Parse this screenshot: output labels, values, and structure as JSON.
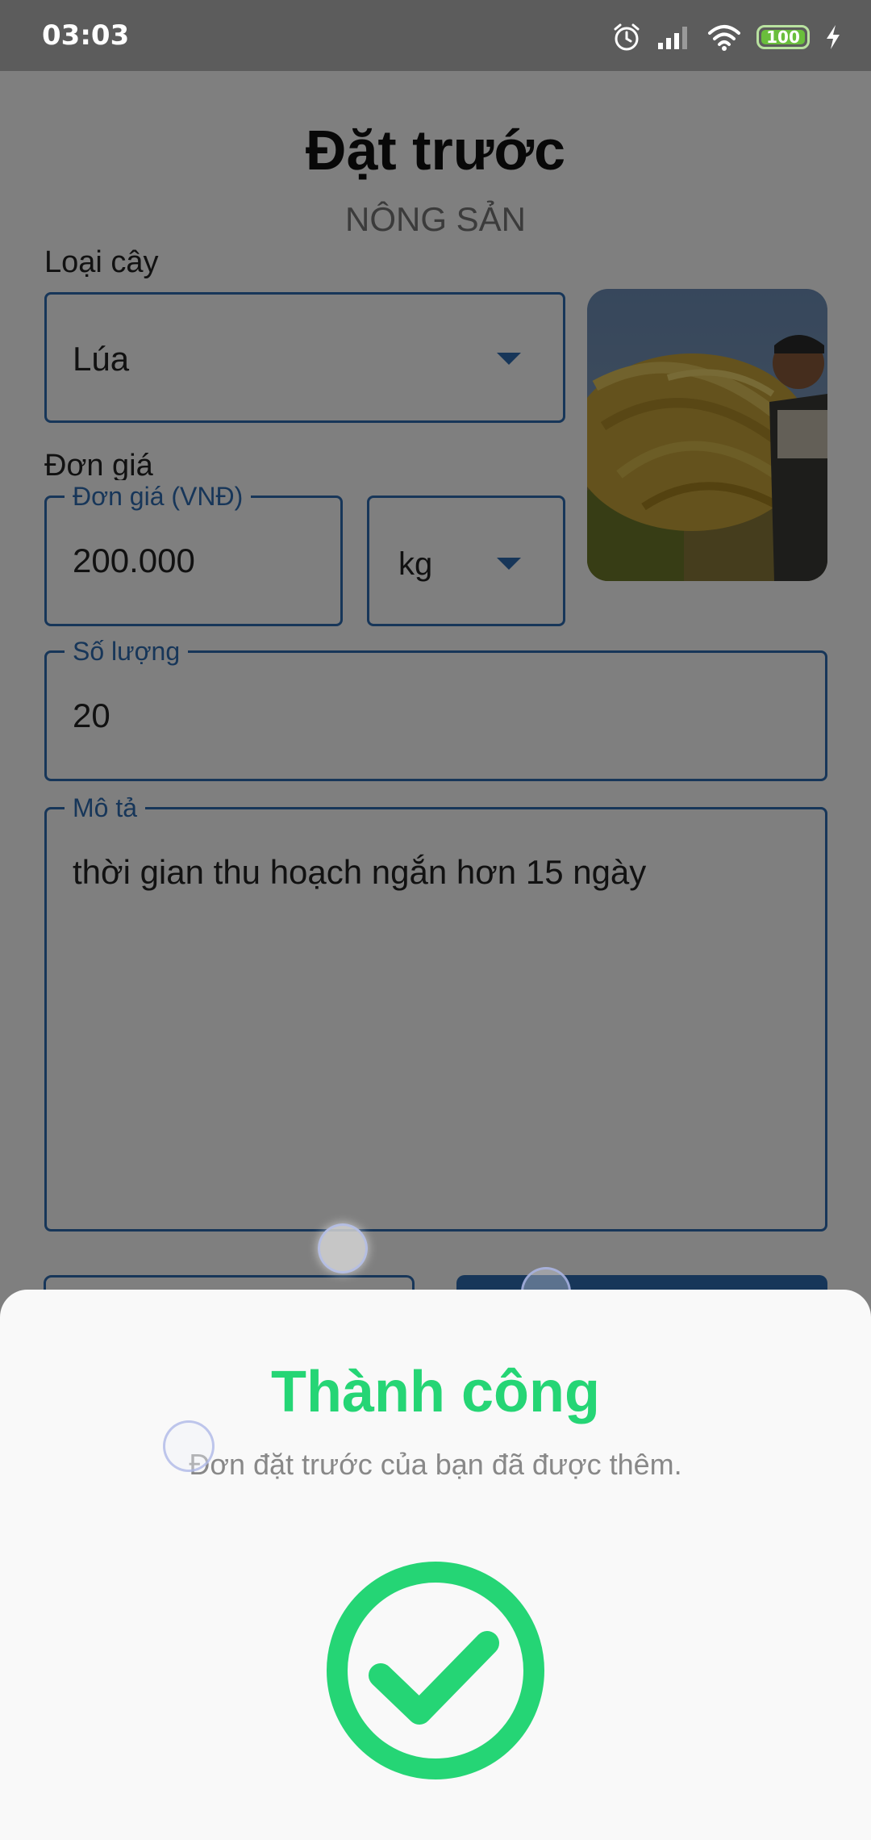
{
  "status_bar": {
    "time": "03:03",
    "battery": "100"
  },
  "header": {
    "title": "Đặt trước",
    "subtitle": "NÔNG SẢN"
  },
  "form": {
    "crop_type_label": "Loại cây",
    "crop_type_value": "Lúa",
    "price_label": "Đơn giá",
    "price_field_legend": "Đơn giá (VNĐ)",
    "price_value": "200.000",
    "unit_value": "kg",
    "quantity_legend": "Số lượng",
    "quantity_value": "20",
    "description_legend": "Mô tả",
    "description_value": "thời gian thu hoạch ngắn hơn 15 ngày"
  },
  "dialog": {
    "title": "Thành công",
    "message": "Đơn đặt trước của bạn đã được thêm.",
    "icon": "check-circle-icon"
  },
  "colors": {
    "accent": "#2f6db3",
    "success": "#25d575",
    "overlay": "rgba(0,0,0,0.5)"
  }
}
